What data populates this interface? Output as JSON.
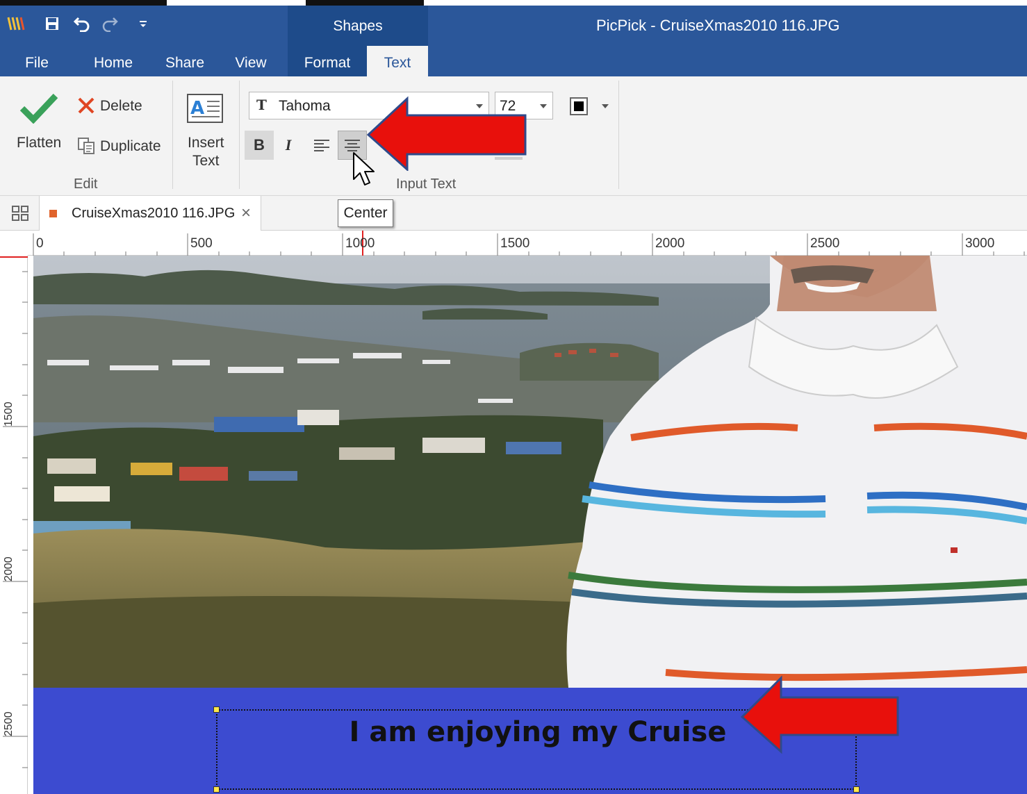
{
  "title_bar": {
    "app_title": "PicPick - CruiseXmas2010 116.JPG",
    "context_tab": "Shapes"
  },
  "quick_access": {
    "icons": [
      "picpick-logo-icon",
      "save-icon",
      "undo-icon",
      "redo-icon",
      "customize-icon"
    ]
  },
  "tabs": [
    "File",
    "Home",
    "Share",
    "View",
    "Format",
    "Text"
  ],
  "active_tab": "Text",
  "ribbon": {
    "edit_group": {
      "flatten_label": "Flatten",
      "delete_label": "Delete",
      "duplicate_label": "Duplicate",
      "group_label": "Edit"
    },
    "insert_text": {
      "line1": "Insert",
      "line2": "Text"
    },
    "input_text_group": {
      "font_name": "Tahoma",
      "font_size": "72",
      "bold_label": "B",
      "italic_label": "I",
      "group_label": "Input Text"
    }
  },
  "document_tab": {
    "filename": "CruiseXmas2010 116.JPG",
    "close_glyph": "×"
  },
  "tooltip": "Center",
  "ruler": {
    "horizontal_labels": [
      "0",
      "500",
      "1000",
      "1500",
      "2000",
      "2500",
      "3000"
    ],
    "vertical_labels": [
      "1500",
      "2000",
      "2500"
    ]
  },
  "canvas": {
    "caption_text": "I am enjoying my Cruise"
  },
  "colors": {
    "title_blue": "#2b579a",
    "caption_band": "#3c4bd0",
    "annotation_arrow": "#e8100c"
  }
}
